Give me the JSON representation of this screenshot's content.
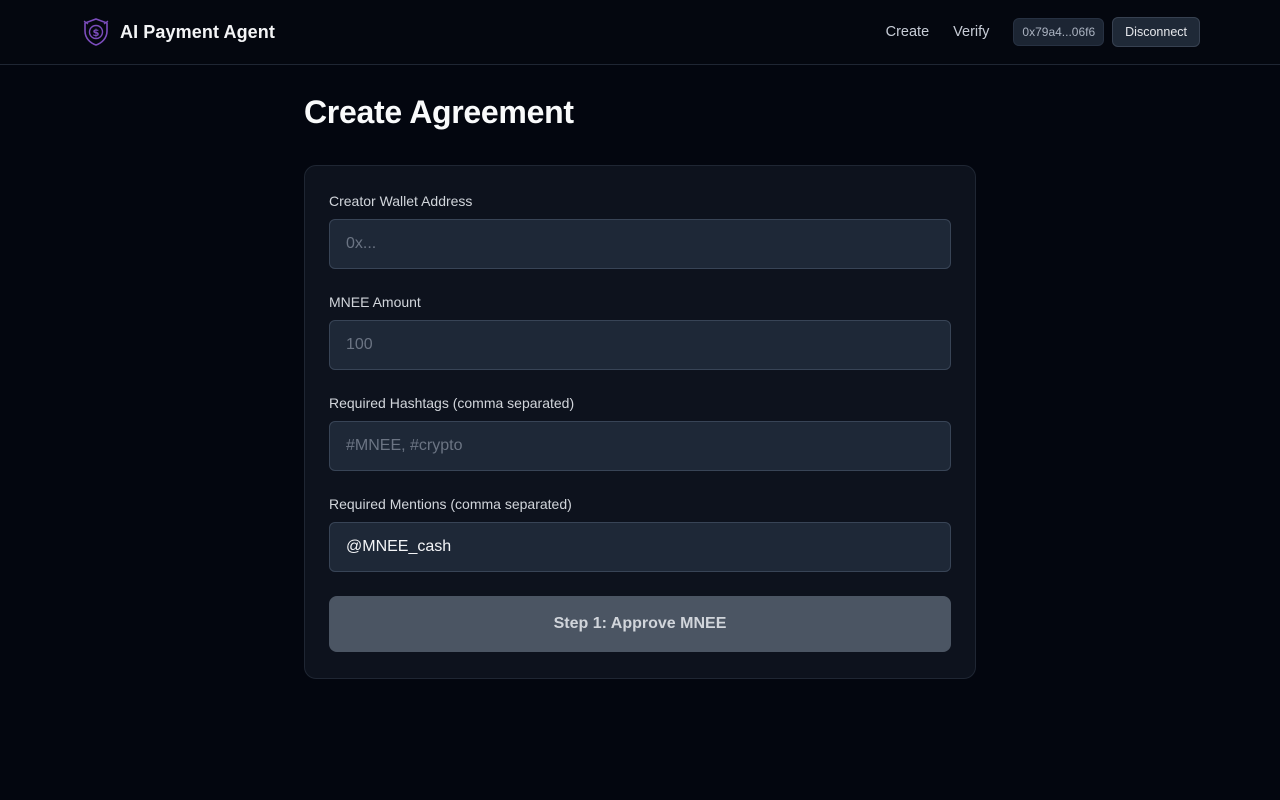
{
  "app": {
    "name": "AI Payment Agent",
    "logo_icon": "shield-dollar-icon"
  },
  "nav": {
    "links": [
      {
        "label": "Create"
      },
      {
        "label": "Verify"
      }
    ],
    "wallet_address": "0x79a4...06f6",
    "disconnect_label": "Disconnect"
  },
  "page": {
    "title": "Create Agreement"
  },
  "form": {
    "creator_wallet": {
      "label": "Creator Wallet Address",
      "placeholder": "0x...",
      "value": ""
    },
    "amount": {
      "label": "MNEE Amount",
      "placeholder": "100",
      "value": ""
    },
    "hashtags": {
      "label": "Required Hashtags (comma separated)",
      "placeholder": "#MNEE, #crypto",
      "value": ""
    },
    "mentions": {
      "label": "Required Mentions (comma separated)",
      "placeholder": "",
      "value": "@MNEE_cash"
    },
    "submit_label": "Step 1: Approve MNEE"
  },
  "colors": {
    "background": "#03060f",
    "card": "#0d121d",
    "input": "#1e2837",
    "button_disabled": "#4b5563",
    "logo_accent": "#7c4dbd"
  }
}
